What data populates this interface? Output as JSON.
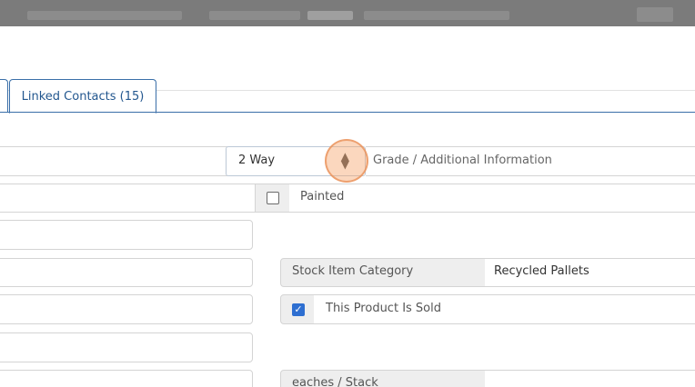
{
  "tabs": {
    "active_label": "Linked Contacts (15)"
  },
  "select": {
    "value": "2 Way",
    "side_label": "Grade / Additional Information"
  },
  "painted": {
    "label": "Painted",
    "checked": false
  },
  "stock_item_category": {
    "label": "Stock Item Category",
    "value": "Recycled Pallets"
  },
  "product_sold": {
    "label": "This Product Is Sold",
    "checked": true
  },
  "eaches_stack": {
    "label": "eaches / Stack"
  }
}
